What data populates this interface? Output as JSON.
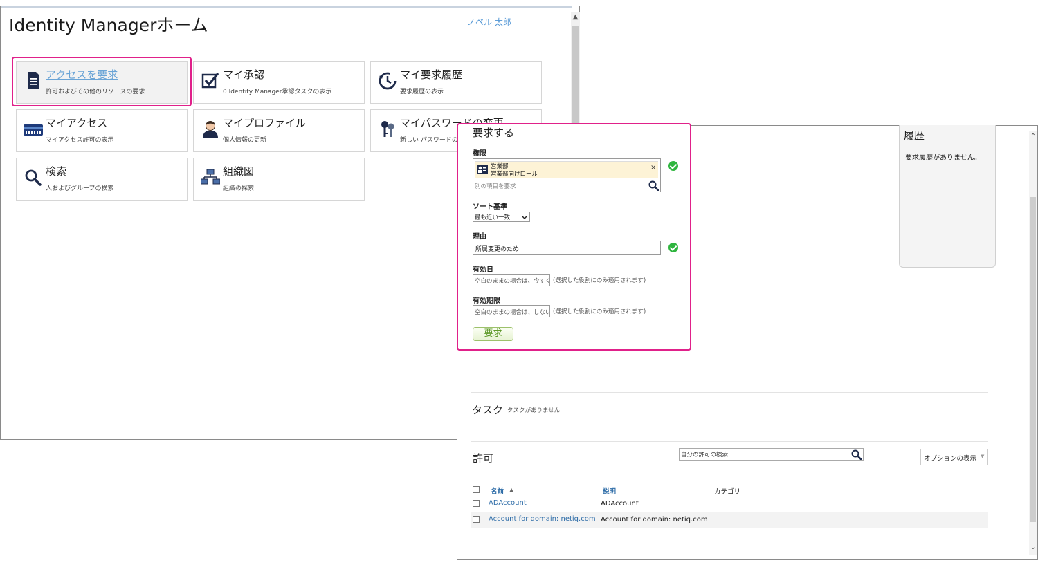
{
  "home": {
    "title": "Identity Managerホーム",
    "user": "ノベル 太郎",
    "tiles": [
      {
        "title": "アクセスを要求",
        "subtitle": "許可およびその他のリソースの要求",
        "icon": "document-icon"
      },
      {
        "title": "マイ承認",
        "subtitle": "0 Identity Manager承認タスクの表示",
        "icon": "checkbox-icon"
      },
      {
        "title": "マイ要求履歴",
        "subtitle": "要求履歴の表示",
        "icon": "history-clock-icon"
      },
      {
        "title": "マイアクセス",
        "subtitle": "マイアクセス許可の表示",
        "icon": "access-card-icon"
      },
      {
        "title": "マイプロファイル",
        "subtitle": "個人情報の更新",
        "icon": "user-profile-icon"
      },
      {
        "title": "マイパスワードの変更",
        "subtitle": "新しい パスワードの作",
        "icon": "keys-icon"
      },
      {
        "title": "検索",
        "subtitle": "人およびグループの検索",
        "icon": "search-icon"
      },
      {
        "title": "組織図",
        "subtitle": "組織の探索",
        "icon": "org-chart-icon"
      }
    ]
  },
  "request": {
    "heading": "要求する",
    "permission_label": "権限",
    "selected_item": {
      "line1": "営業部",
      "line2": "営業部向けロール"
    },
    "other_item_placeholder": "別の項目を要求",
    "sort_label": "ソート基準",
    "sort_value": "最も近い一致",
    "reason_label": "理由",
    "reason_value": "所属変更のため",
    "effective_label": "有効日",
    "effective_placeholder": "空白のままの場合は、今すぐ",
    "effective_note": "(選択した役割にのみ適用されます)",
    "expiry_label": "有効期限",
    "expiry_placeholder": "空白のままの場合は、しない",
    "expiry_note": "(選択した役割にのみ適用されます)",
    "submit_label": "要求"
  },
  "history": {
    "title": "履歴",
    "empty": "要求履歴がありません。"
  },
  "tasks": {
    "title": "タスク",
    "empty": "タスクがありません"
  },
  "permissions": {
    "title": "許可",
    "search_placeholder": "自分の許可の検索",
    "options_label": "オプションの表示",
    "columns": {
      "name": "名前",
      "description": "説明",
      "category": "カテゴリ"
    },
    "rows": [
      {
        "name": "ADAccount",
        "description": "ADAccount",
        "category": ""
      },
      {
        "name": "Account for domain: netiq.com",
        "description": "Account for domain: netiq.com",
        "category": ""
      }
    ]
  },
  "colors": {
    "highlight": "#e0218a",
    "link": "#2f6da8",
    "ok": "#2fb53f"
  }
}
